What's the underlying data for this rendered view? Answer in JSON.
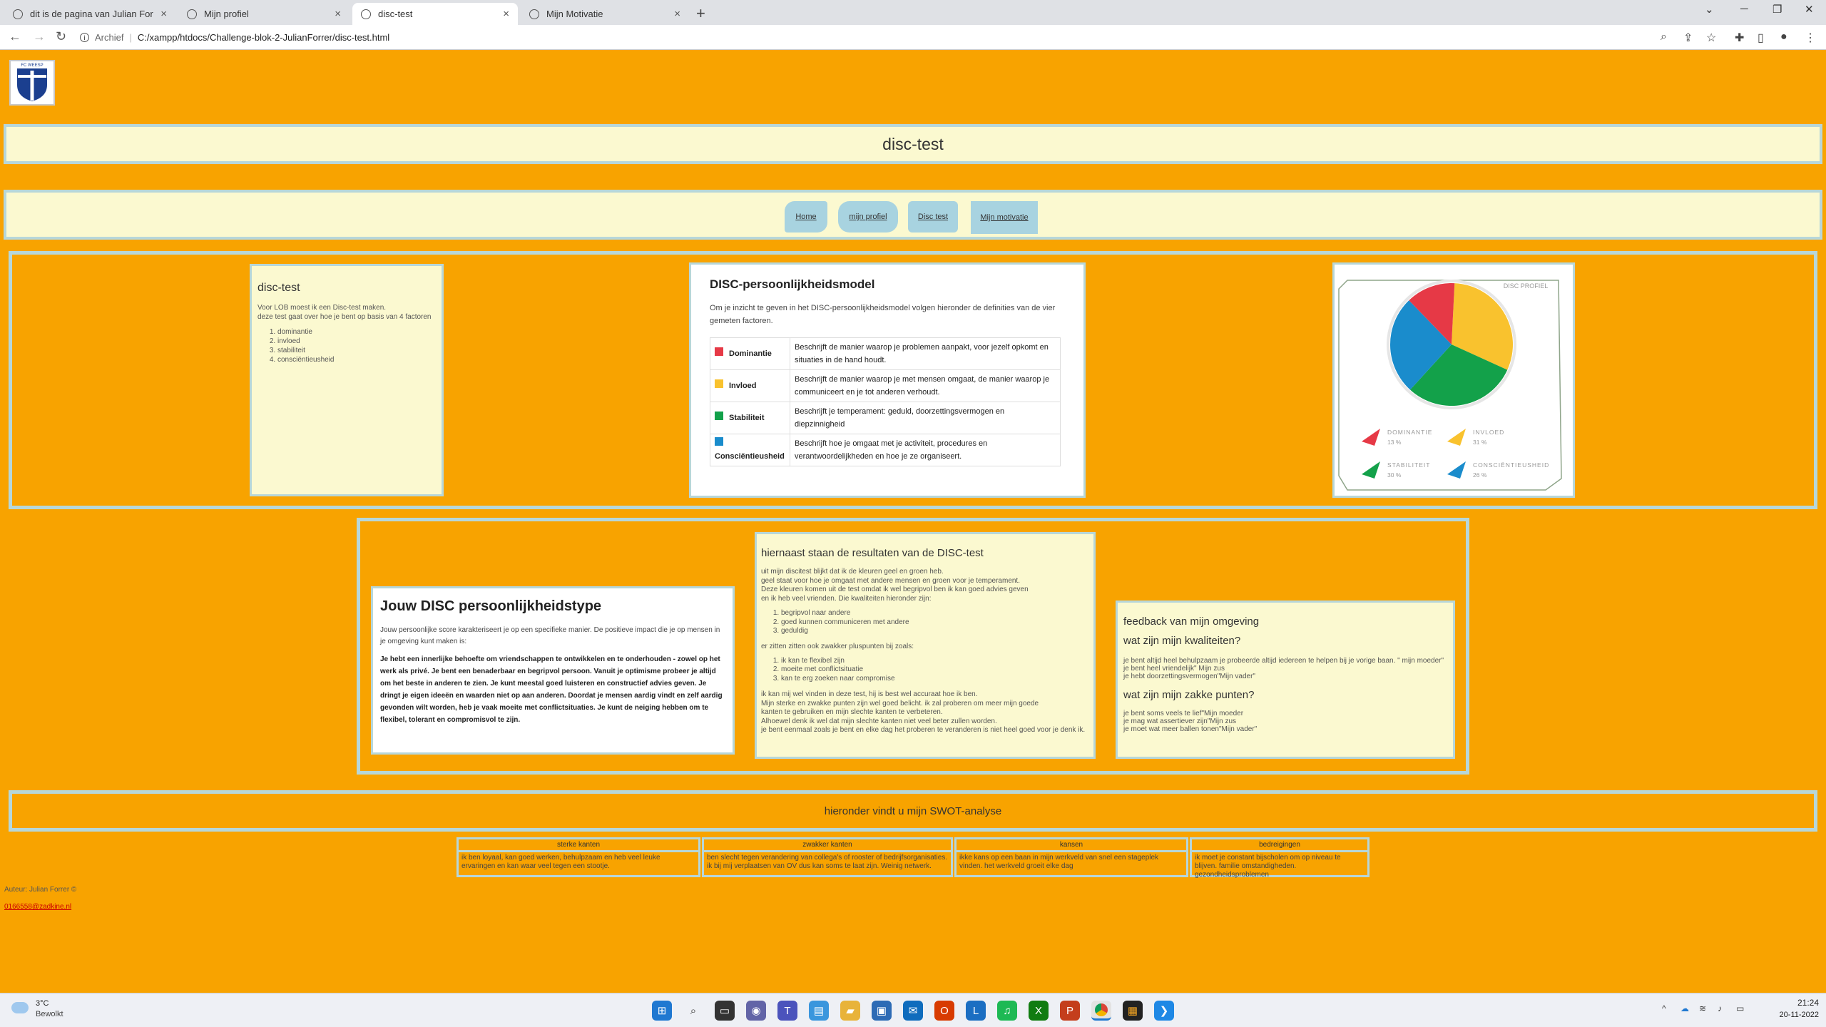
{
  "browser": {
    "tabs": [
      {
        "title": "dit is de pagina van Julian Forrer"
      },
      {
        "title": "Mijn profiel"
      },
      {
        "title": "disc-test"
      },
      {
        "title": "Mijn Motivatie"
      }
    ],
    "address": {
      "label": "Archief",
      "url": "C:/xampp/htdocs/Challenge-blok-2-JulianForrer/disc-test.html"
    }
  },
  "site": {
    "logo_text": "FC WEESP",
    "page_title": "disc-test",
    "nav": [
      {
        "label": "Home"
      },
      {
        "label": "mijn profiel"
      },
      {
        "label": "Disc test"
      },
      {
        "label": "Mijn motivatie"
      }
    ]
  },
  "intro": {
    "heading": "disc-test",
    "text1": "Voor LOB moest ik een Disc-test maken.",
    "text2": "deze test gaat over hoe je bent op basis van 4 factoren",
    "factors": [
      "dominantie",
      "invloed",
      "stabiliteit",
      "consciëntieusheid"
    ]
  },
  "model": {
    "heading": "DISC-persoonlijkheidsmodel",
    "intro": "Om je inzicht te geven in het DISC-persoonlijkheidsmodel volgen hieronder de definities van de vier gemeten factoren.",
    "rows": [
      {
        "name": "Dominantie",
        "color": "#e63946",
        "desc": "Beschrijft de manier waarop je problemen aanpakt, voor jezelf opkomt en situaties in de hand houdt."
      },
      {
        "name": "Invloed",
        "color": "#f9c22e",
        "desc": "Beschrijft de manier waarop je met mensen omgaat, de manier waarop je communiceert en je tot anderen verhoudt."
      },
      {
        "name": "Stabiliteit",
        "color": "#13a14a",
        "desc": "Beschrijft je temperament: geduld, doorzettingsvermogen en diepzinnigheid"
      },
      {
        "name": "Consciëntieusheid",
        "color": "#1a8ccc",
        "desc": "Beschrijft hoe je omgaat met je activiteit, procedures en verantwoordelijkheden en hoe je ze organiseert."
      }
    ]
  },
  "chart_data": {
    "type": "pie",
    "title": "DISC PROFIEL",
    "categories": [
      "DOMINANTIE",
      "INVLOED",
      "STABILITEIT",
      "CONSCIËNTIEUSHEID"
    ],
    "values": [
      13,
      31,
      30,
      26
    ],
    "colors": [
      "#e63946",
      "#f9c22e",
      "#13a14a",
      "#1a8ccc"
    ],
    "value_labels": [
      "13 %",
      "31 %",
      "30 %",
      "26 %"
    ]
  },
  "type_card": {
    "heading": "Jouw DISC persoonlijkheidstype",
    "intro": "Jouw persoonlijke score karakteriseert je op een specifieke manier. De positieve impact die je op mensen in je omgeving kunt maken is:",
    "bold": "Je hebt een innerlijke behoefte om vriendschappen te ontwikkelen en te onderhouden - zowel op het werk als privé. Je bent een benaderbaar en begripvol persoon. Vanuit je optimisme probeer je altijd om het beste in anderen te zien. Je kunt meestal goed luisteren en constructief advies geven. Je dringt je eigen ideeën en waarden niet op aan anderen. Doordat je mensen aardig vindt en zelf aardig gevonden wilt worden, heb je vaak moeite met conflictsituaties. Je kunt de neiging hebben om te flexibel, tolerant en compromisvol te zijn."
  },
  "results": {
    "heading": "hiernaast staan de resultaten van de DISC-test",
    "p1": [
      "uit mijn discitest blijkt dat ik de kleuren geel en groen heb.",
      "geel staat voor hoe je omgaat met andere mensen en groen voor je temperament.",
      "Deze kleuren komen uit de test omdat ik wel begripvol ben ik kan goed advies geven",
      "en ik heb veel vrienden. Die kwaliteiten hieronder zijn:"
    ],
    "list1": [
      "begripvol naar andere",
      "goed kunnen communiceren met andere",
      "geduldig"
    ],
    "p2": "er zitten zitten ook zwakker pluspunten bij zoals:",
    "list2": [
      "ik kan te flexibel zijn",
      "moeite met conflictsituatie",
      "kan te erg zoeken naar compromise"
    ],
    "p3": [
      "ik kan mij wel vinden in deze test, hij is best wel accuraat hoe ik ben.",
      "Mijn sterke en zwakke punten zijn wel goed belicht. ik zal proberen om meer mijn goede",
      "kanten te gebruiken en mijn slechte kanten te verbeteren.",
      "Alhoewel denk ik wel dat mijn slechte kanten niet veel beter zullen worden.",
      "je bent eenmaal zoals je bent en elke dag het proberen te veranderen is niet heel goed voor je denk ik."
    ]
  },
  "feedback": {
    "heading": "feedback van mijn omgeving",
    "q1": "wat zijn mijn kwaliteiten?",
    "a1": [
      "je bent altijd heel behulpzaam je probeerde altijd iedereen te helpen bij je vorige baan. \" mijn moeder\"",
      "je bent heel vriendelijk\" Mijn zus",
      "je hebt doorzettingsvermogen\"Mijn vader\""
    ],
    "q2": "wat zijn mijn zakke punten?",
    "a2": [
      "je bent soms veels te lief\"Mijn moeder",
      "je mag wat assertiever zijn\"Mijn zus",
      "je moet wat meer ballen tonen\"Mijn vader\""
    ]
  },
  "swot": {
    "banner": "hieronder vindt u mijn SWOT-analyse",
    "cols": [
      {
        "head": "sterke kanten",
        "body": "ik ben loyaal, kan goed werken, behulpzaam en heb veel leuke ervaringen en kan waar veel tegen een stootje."
      },
      {
        "head": "zwakker kanten",
        "body": "ben slecht tegen verandering van collega's of rooster of bedrijfsorganisaties. ik bij mij verplaatsen van OV dus kan soms te laat zijn. Weinig netwerk."
      },
      {
        "head": "kansen",
        "body": "ikke kans op een baan in mijn werkveld van snel een stageplek vinden. het werkveld groeit elke dag"
      },
      {
        "head": "bedreigingen",
        "body": "ik moet je constant bijscholen om op niveau te blijven. familie omstandigheden. gezondheidsproblemen"
      }
    ]
  },
  "footer": {
    "author": "Auteur: Julian Forrer ©",
    "email": "0166558@zadkine.nl"
  },
  "taskbar": {
    "temp": "3°C",
    "weather": "Bewolkt",
    "time": "21:24",
    "date": "20-11-2022"
  }
}
